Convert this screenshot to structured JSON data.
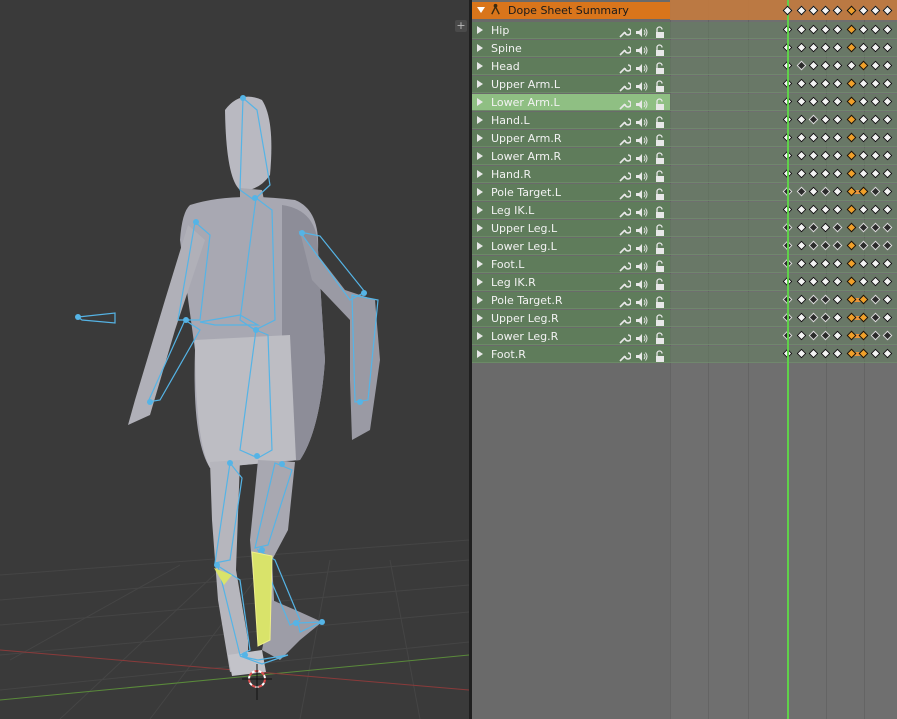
{
  "viewport": {
    "corner_button_label": "+",
    "bone_color": "#55b4e6",
    "selected_bone_color": "#d9e36a"
  },
  "dopesheet": {
    "summary_label": "Dope Sheet Summary",
    "channels": [
      {
        "label": "Hip",
        "selected": false,
        "keys": "wwwwwowww"
      },
      {
        "label": "Spine",
        "selected": false,
        "keys": "wwwwwowww"
      },
      {
        "label": "Head",
        "selected": false,
        "keys": "wbwwwwoww"
      },
      {
        "label": "Upper Arm.L",
        "selected": false,
        "keys": "wwwwwowww"
      },
      {
        "label": "Lower Arm.L",
        "selected": true,
        "keys": "wwwwwowww"
      },
      {
        "label": "Hand.L",
        "selected": false,
        "keys": "wwbwwowww"
      },
      {
        "label": "Upper Arm.R",
        "selected": false,
        "keys": "wwwwwowww"
      },
      {
        "label": "Lower Arm.R",
        "selected": false,
        "keys": "wwwwwowww"
      },
      {
        "label": "Hand.R",
        "selected": false,
        "keys": "wwwwwowww"
      },
      {
        "label": "Pole Target.L",
        "selected": false,
        "keys": "bbwbwoobw"
      },
      {
        "label": "Leg IK.L",
        "selected": false,
        "keys": "wwwwwowww"
      },
      {
        "label": "Upper Leg.L",
        "selected": false,
        "keys": "bwbwbobbb"
      },
      {
        "label": "Lower Leg.L",
        "selected": false,
        "keys": "bwbbbobbb"
      },
      {
        "label": "Foot.L",
        "selected": false,
        "keys": "bwwwwowww"
      },
      {
        "label": "Leg IK.R",
        "selected": false,
        "keys": "wwwwwowww"
      },
      {
        "label": "Pole Target.R",
        "selected": false,
        "keys": "bwbbwoobw"
      },
      {
        "label": "Upper Leg.R",
        "selected": false,
        "keys": "bwbbwoobw"
      },
      {
        "label": "Lower Leg.R",
        "selected": false,
        "keys": "bwbbwoobb"
      },
      {
        "label": "Foot.R",
        "selected": false,
        "keys": "wwwwwooww"
      }
    ],
    "colors": {
      "summary": "#d9751b",
      "channel": "#5f7c5b",
      "channel_selected": "#8fbf83",
      "playhead": "#5fd14a",
      "selected_key": "#f0a02a"
    }
  }
}
